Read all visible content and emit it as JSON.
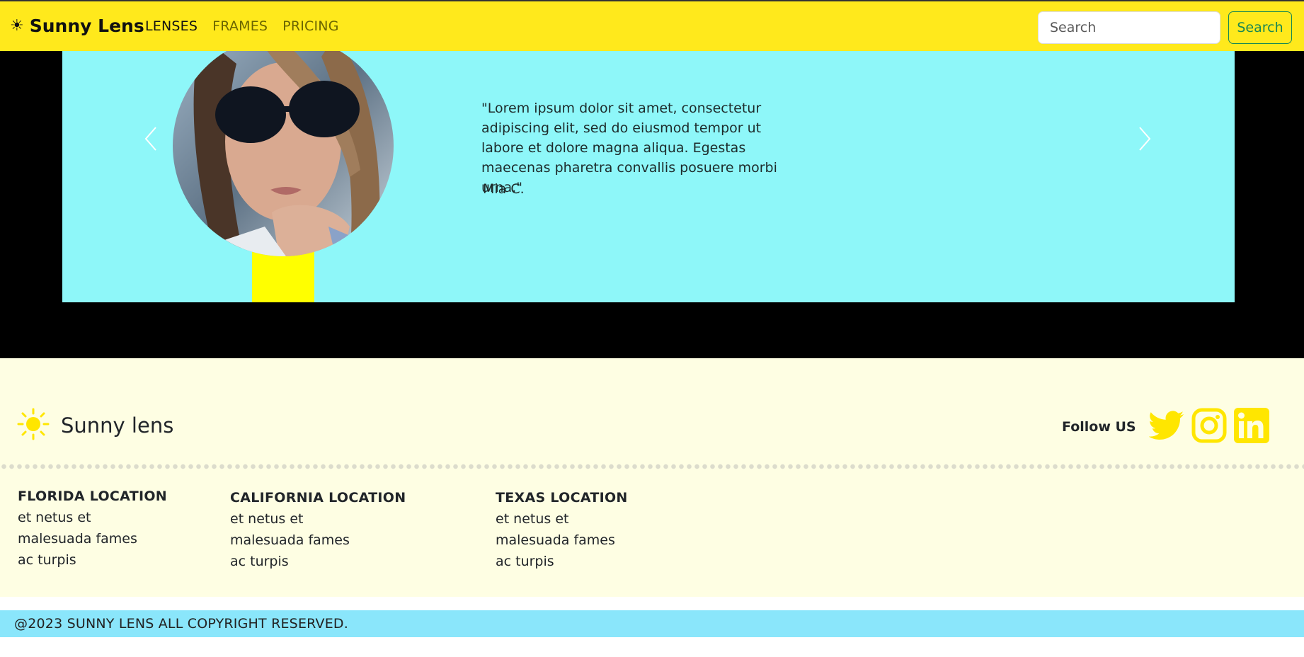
{
  "navbar": {
    "brand_icon": "☀",
    "brand": "Sunny Lens",
    "links": [
      "LENSES",
      "FRAMES",
      "PRICING"
    ],
    "search_placeholder": "Search",
    "search_button": "Search"
  },
  "testimonial": {
    "quote": "\"Lorem ipsum dolor sit amet, consectetur adipiscing elit, sed do eiusmod tempor ut labore et dolore magna aliqua. Egestas maecenas pharetra convallis posuere morbi urna.\"",
    "author": "Mia C.",
    "prev_icon": "chevron-left-icon",
    "next_icon": "chevron-right-icon"
  },
  "footer": {
    "brand": "Sunny lens",
    "follow_label": "Follow US",
    "social_icons": [
      "twitter-icon",
      "instagram-icon",
      "linkedin-icon"
    ],
    "locations": [
      {
        "title": "FLORIDA LOCATION",
        "lines": [
          "et netus et",
          "malesuada fames",
          "ac turpis"
        ]
      },
      {
        "title": "CALIFORNIA LOCATION",
        "lines": [
          "et netus et",
          "malesuada fames",
          "ac turpis"
        ]
      },
      {
        "title": "TEXAS LOCATION",
        "lines": [
          "et netus et",
          "malesuada fames",
          "ac turpis"
        ]
      }
    ],
    "copyright": "@2023 SUNNY LENS ALL COPYRIGHT RESERVED."
  },
  "colors": {
    "navbar_bg": "#ffe91c",
    "slide_bg": "#8ef7f9",
    "footer_bg": "#fefee3",
    "copyright_bg": "#8ae6fb",
    "social_yellow": "#ffe600",
    "search_button": "#198754"
  }
}
